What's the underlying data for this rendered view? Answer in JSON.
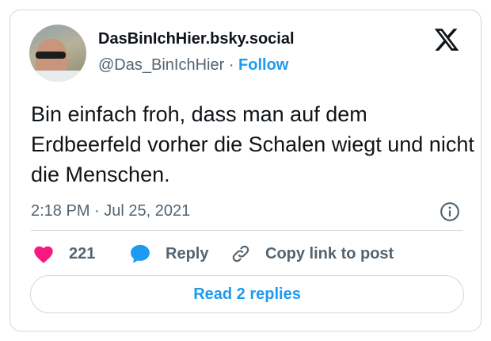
{
  "author": {
    "display_name": "DasBinIchHier.bsky.social",
    "handle": "@Das_BinIchHier",
    "separator": "·",
    "follow_label": "Follow"
  },
  "post": {
    "text": "Bin einfach froh, dass man auf dem Erdbeerfeld vorher die Schalen wiegt und nicht die Menschen.",
    "timestamp": "2:18 PM · Jul 25, 2021"
  },
  "actions": {
    "likes_count": "221",
    "reply_label": "Reply",
    "copy_link_label": "Copy link to post"
  },
  "footer": {
    "read_replies_label": "Read 2 replies"
  },
  "icons": {
    "logo": "x-logo-icon",
    "info": "info-icon",
    "like": "heart-icon",
    "reply": "speech-bubble-icon",
    "copy": "link-icon"
  },
  "colors": {
    "accent": "#1d9bf0",
    "heart": "#f91880",
    "text": "#0f1419",
    "muted": "#536471",
    "border": "#cfd9de"
  }
}
